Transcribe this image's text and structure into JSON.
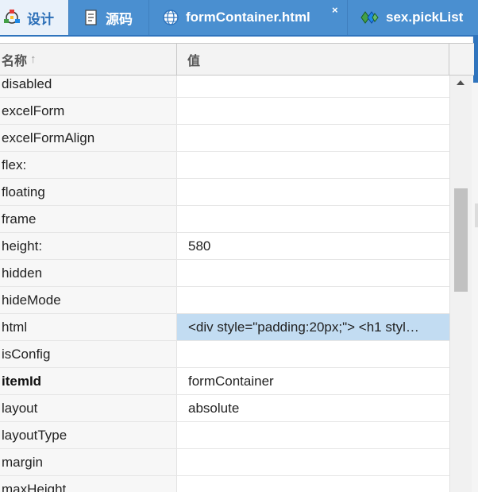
{
  "tabs": [
    {
      "label": "设计",
      "icon": "design-icon",
      "active": true
    },
    {
      "label": "源码",
      "icon": "source-icon",
      "active": false
    },
    {
      "label": "formContainer.html",
      "icon": "globe-icon",
      "active": false,
      "close": "×"
    },
    {
      "label": "sex.pickList",
      "icon": "picklist-icon",
      "active": false
    }
  ],
  "grid": {
    "header": {
      "name": "名称",
      "sort_icon": "↑",
      "value": "值"
    },
    "rows": [
      {
        "name": "disabled",
        "value": ""
      },
      {
        "name": "excelForm",
        "value": ""
      },
      {
        "name": "excelFormAlign",
        "value": ""
      },
      {
        "name": "flex:",
        "value": ""
      },
      {
        "name": "floating",
        "value": ""
      },
      {
        "name": "frame",
        "value": ""
      },
      {
        "name": "height:",
        "value": "580"
      },
      {
        "name": "hidden",
        "value": ""
      },
      {
        "name": "hideMode",
        "value": ""
      },
      {
        "name": "html",
        "value": "<div style=\"padding:20px;\"> <h1 styl…",
        "selected": true
      },
      {
        "name": "isConfig",
        "value": ""
      },
      {
        "name": "itemId",
        "value": "formContainer",
        "bold": true
      },
      {
        "name": "layout",
        "value": "absolute"
      },
      {
        "name": "layoutType",
        "value": ""
      },
      {
        "name": "margin",
        "value": ""
      },
      {
        "name": "maxHeight",
        "value": ""
      }
    ]
  },
  "colors": {
    "tabbar": "#5b9bd5",
    "active_tab_text": "#2c6fb7",
    "selected_row": "#c2dcf2"
  }
}
